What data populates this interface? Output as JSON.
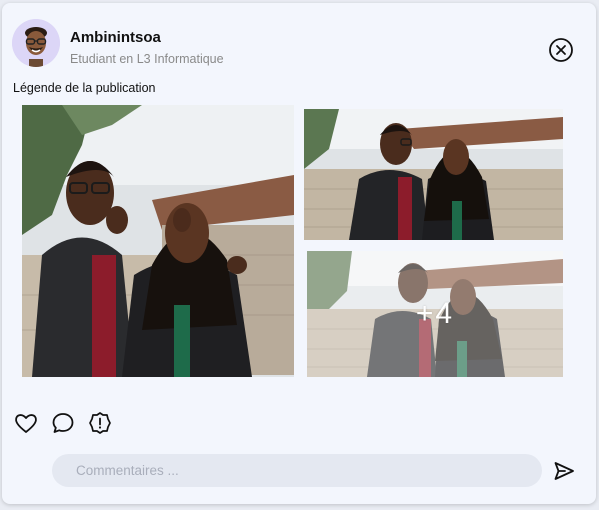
{
  "post": {
    "author": {
      "name": "Ambinintsoa",
      "subtitle": "Etudiant en L3 Informatique",
      "avatar_icon": "memoji-avatar-icon"
    },
    "caption": "Légende de la publication",
    "more_photos_label": "+4",
    "actions": [
      {
        "icon": "heart-icon"
      },
      {
        "icon": "comment-icon"
      },
      {
        "icon": "alert-icon"
      }
    ],
    "comment": {
      "placeholder": "Commentaires ...",
      "value": ""
    },
    "close_icon": "close-circle-icon",
    "send_icon": "send-icon"
  },
  "colors": {
    "card_background": "#f3f6fd",
    "avatar_background": "#dcd6f7",
    "comment_background": "#e4e8f1",
    "icon_stroke": "#111111"
  }
}
